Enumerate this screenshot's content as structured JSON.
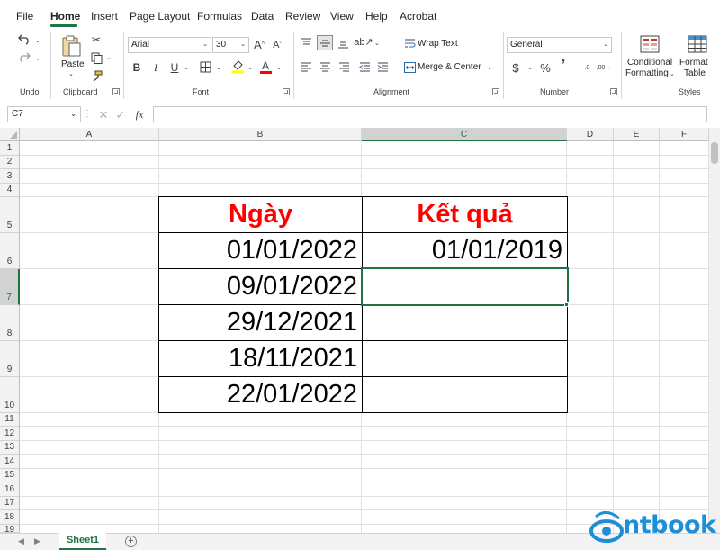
{
  "menu": {
    "tabs": [
      "File",
      "Home",
      "Insert",
      "Page Layout",
      "Formulas",
      "Data",
      "Review",
      "View",
      "Help",
      "Acrobat"
    ],
    "active": "Home"
  },
  "ribbon": {
    "undo_group_label": "Undo",
    "clipboard": {
      "label": "Clipboard",
      "paste_label": "Paste"
    },
    "font": {
      "label": "Font",
      "name": "Arial",
      "size": "30"
    },
    "alignment": {
      "label": "Alignment",
      "wrap_text": "Wrap Text",
      "merge_center": "Merge & Center"
    },
    "number": {
      "label": "Number",
      "format": "General",
      "currency": "$",
      "percent": "%",
      "comma": "’",
      "inc_decimal": "←.0",
      "dec_decimal": ".00→"
    },
    "styles": {
      "label": "Styles",
      "conditional_formatting_line1": "Conditional",
      "conditional_formatting_line2": "Formatting",
      "format_table_line1": "Format",
      "format_table_line2": "Table"
    }
  },
  "formula_bar": {
    "name_box": "C7",
    "fx": "fx",
    "value": ""
  },
  "sheet": {
    "columns": [
      "A",
      "B",
      "C",
      "D",
      "E",
      "F"
    ],
    "selected_column": "C",
    "rows": [
      "1",
      "2",
      "3",
      "4",
      "5",
      "6",
      "7",
      "8",
      "9",
      "10",
      "11",
      "12",
      "13",
      "14",
      "15",
      "16",
      "17",
      "18",
      "19"
    ],
    "selected_row": "7",
    "table": {
      "header_b": "Ngày",
      "header_c": "Kết quả",
      "dates": [
        "01/01/2022",
        "09/01/2022",
        "29/12/2021",
        "18/11/2021",
        "22/01/2022"
      ],
      "results": [
        "01/01/2019",
        "",
        "",
        "",
        ""
      ]
    }
  },
  "sheet_tabs": {
    "active": "Sheet1",
    "add": "+"
  },
  "logo": {
    "text": "ntbook"
  },
  "colors": {
    "accent": "#217346",
    "header_text": "#ff0000",
    "logo": "#1e8fd6"
  }
}
